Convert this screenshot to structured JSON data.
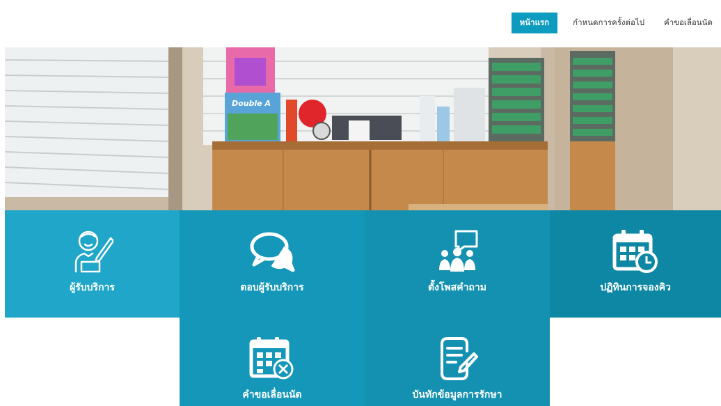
{
  "nav": {
    "items": [
      {
        "label": "หน้าแรก",
        "active": true
      },
      {
        "label": "กำหนดการครั้งต่อไป",
        "active": false
      },
      {
        "label": "คำขอเลื่อนนัด",
        "active": false
      }
    ]
  },
  "tiles": [
    {
      "label": "ผู้รับบริการ",
      "icon": "user-writing-icon"
    },
    {
      "label": "ตอบผู้รับบริการ",
      "icon": "chat-bubbles-icon"
    },
    {
      "label": "ตั้งโพสคำถาม",
      "icon": "group-question-icon"
    },
    {
      "label": "ปฏิทินการจองคิว",
      "icon": "calendar-clock-icon"
    },
    {
      "label": "คำขอเลื่อนนัด",
      "icon": "calendar-cancel-icon"
    },
    {
      "label": "บันทักข้อมูลการรักษา",
      "icon": "document-edit-icon"
    }
  ],
  "hero": {
    "icon": "room-photo-image",
    "sign_text": "Double A"
  },
  "colors": {
    "accent": "#0d9bc0",
    "tile1": "#1fa6c9",
    "tile2": "#1497b9",
    "tile3": "#1491b1",
    "tile4": "#0d87a4"
  }
}
